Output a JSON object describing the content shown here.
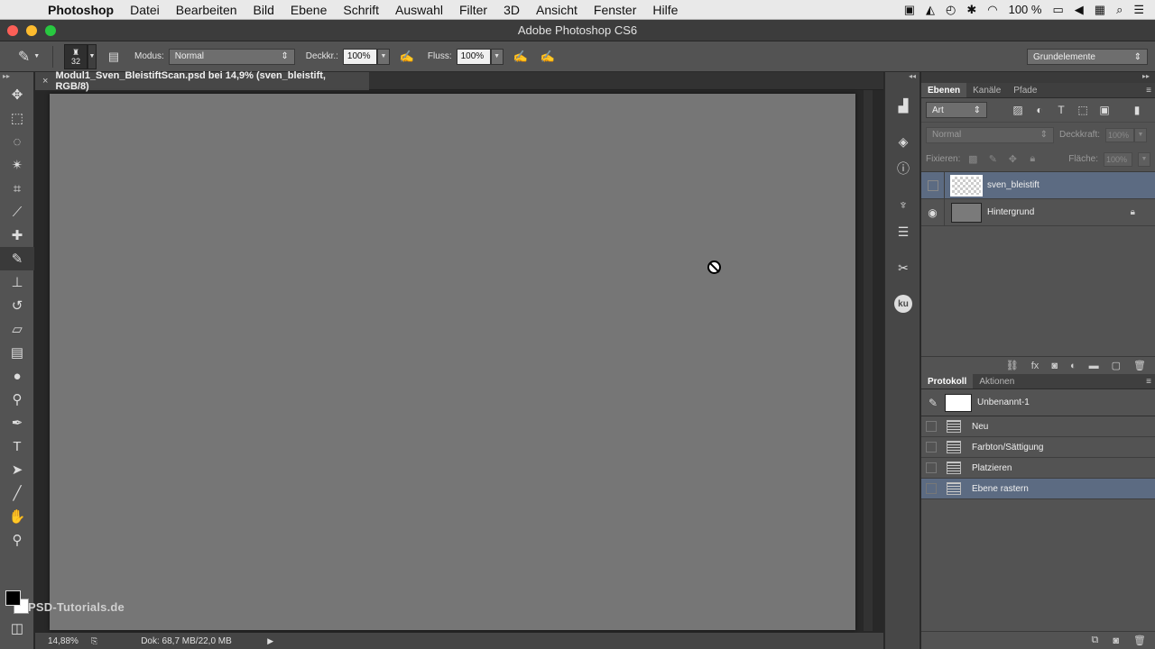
{
  "menubar": {
    "app": "Photoshop",
    "items": [
      "Datei",
      "Bearbeiten",
      "Bild",
      "Ebene",
      "Schrift",
      "Auswahl",
      "Filter",
      "3D",
      "Ansicht",
      "Fenster",
      "Hilfe"
    ],
    "battery": "100 %"
  },
  "window": {
    "title": "Adobe Photoshop CS6"
  },
  "options": {
    "brush_size": "32",
    "mode_label": "Modus:",
    "mode_value": "Normal",
    "opacity_label": "Deckkr.:",
    "opacity_value": "100%",
    "flow_label": "Fluss:",
    "flow_value": "100%",
    "workspace": "Grundelemente"
  },
  "document": {
    "tab_title": "Modul1_Sven_BleistiftScan.psd bei 14,9% (sven_bleistift, RGB/8)",
    "close_glyph": "×",
    "zoom": "14,88%",
    "doc_info": "Dok: 68,7 MB/22,0 MB",
    "watermark": "PSD-Tutorials.de"
  },
  "layers_panel": {
    "tabs": [
      "Ebenen",
      "Kanäle",
      "Pfade"
    ],
    "filter_kind": "Art",
    "blend_mode": "Normal",
    "opacity_label": "Deckkraft:",
    "opacity_value": "100%",
    "lock_label": "Fixieren:",
    "fill_label": "Fläche:",
    "fill_value": "100%",
    "layers": [
      {
        "name": "sven_bleistift",
        "visible": false,
        "selected": true
      },
      {
        "name": "Hintergrund",
        "visible": true,
        "selected": false,
        "locked": true
      }
    ]
  },
  "history_panel": {
    "tabs": [
      "Protokoll",
      "Aktionen"
    ],
    "snapshot": "Unbenannt-1",
    "steps": [
      {
        "label": "Neu",
        "selected": false
      },
      {
        "label": "Farbton/Sättigung",
        "selected": false
      },
      {
        "label": "Platzieren",
        "selected": false
      },
      {
        "label": "Ebene rastern",
        "selected": true
      }
    ]
  },
  "colors": {
    "selection": "#5c6b82",
    "canvas": "#767676",
    "panel": "#535353"
  }
}
